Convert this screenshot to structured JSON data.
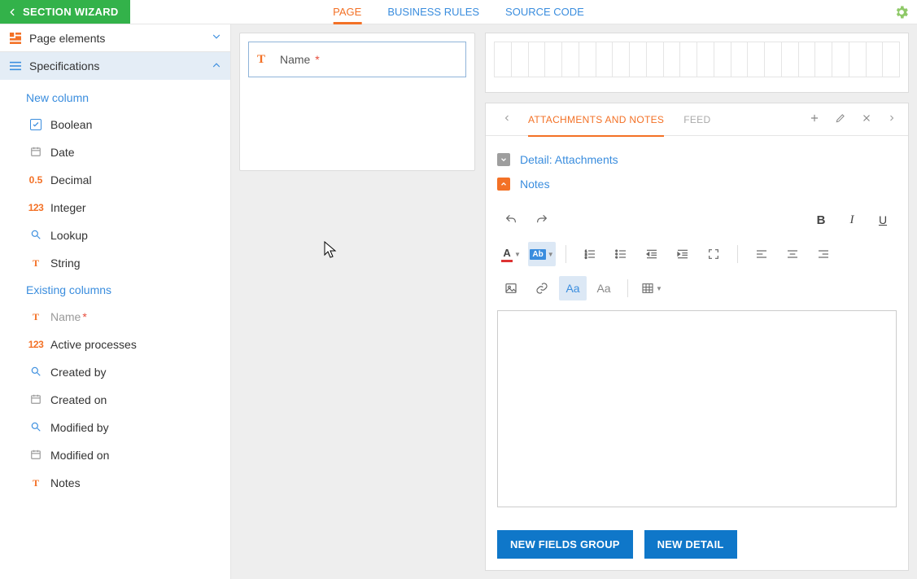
{
  "header": {
    "back_label": "SECTION WIZARD",
    "tabs": [
      "PAGE",
      "BUSINESS RULES",
      "SOURCE CODE"
    ],
    "active_tab_index": 0
  },
  "sidebar": {
    "panel_elements_label": "Page elements",
    "panel_specs_label": "Specifications",
    "new_column_title": "New column",
    "new_columns": [
      {
        "type": "bool",
        "label": "Boolean"
      },
      {
        "type": "date",
        "label": "Date"
      },
      {
        "type": "dec",
        "label": "Decimal",
        "icon_text": "0.5"
      },
      {
        "type": "int",
        "label": "Integer",
        "icon_text": "123"
      },
      {
        "type": "look",
        "label": "Lookup"
      },
      {
        "type": "str",
        "label": "String"
      }
    ],
    "existing_title": "Existing columns",
    "existing_columns": [
      {
        "type": "str",
        "label": "Name",
        "required": true,
        "muted": true
      },
      {
        "type": "int",
        "label": "Active processes",
        "icon_text": "123"
      },
      {
        "type": "look",
        "label": "Created by"
      },
      {
        "type": "date",
        "label": "Created on"
      },
      {
        "type": "look",
        "label": "Modified by"
      },
      {
        "type": "date",
        "label": "Modified on"
      },
      {
        "type": "str",
        "label": "Notes"
      }
    ]
  },
  "left_card": {
    "field_label": "Name",
    "required": true
  },
  "detail_panel": {
    "grid_columns": 24,
    "tabs": [
      "ATTACHMENTS AND NOTES",
      "FEED"
    ],
    "active_tab_index": 0,
    "items": [
      {
        "label": "Detail: Attachments",
        "variant": "grey"
      },
      {
        "label": "Notes",
        "variant": "orange"
      }
    ],
    "footer_buttons": {
      "new_fields_group": "NEW FIELDS GROUP",
      "new_detail": "NEW DETAIL"
    }
  },
  "editor_toolbar": {
    "bold": "B",
    "italic": "I",
    "underline": "U",
    "font_color_letter": "A",
    "bg_color_text": "Ab",
    "aa_blue": "Aa",
    "aa_grey": "Aa"
  }
}
